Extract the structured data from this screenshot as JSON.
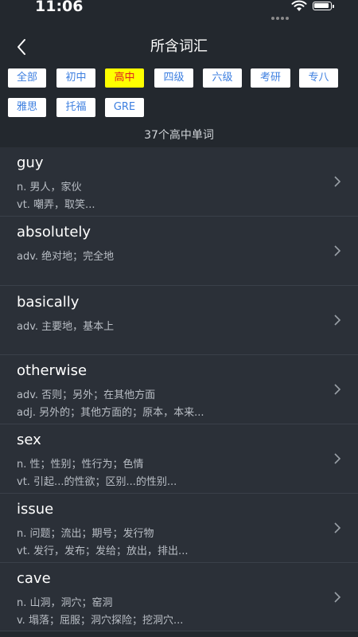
{
  "status": {
    "time": "11:06"
  },
  "nav": {
    "title": "所含词汇"
  },
  "filters": [
    {
      "label": "全部",
      "active": false
    },
    {
      "label": "初中",
      "active": false
    },
    {
      "label": "高中",
      "active": true
    },
    {
      "label": "四级",
      "active": false
    },
    {
      "label": "六级",
      "active": false
    },
    {
      "label": "考研",
      "active": false
    },
    {
      "label": "专八",
      "active": false
    },
    {
      "label": "雅思",
      "active": false
    },
    {
      "label": "托福",
      "active": false
    },
    {
      "label": "GRE",
      "active": false
    }
  ],
  "count_text": "37个高中单词",
  "words": [
    {
      "word": "guy",
      "defs": [
        "n. 男人，家伙",
        "vt. 嘲弄，取笑..."
      ]
    },
    {
      "word": "absolutely",
      "defs": [
        "adv. 绝对地；完全地"
      ]
    },
    {
      "word": "basically",
      "defs": [
        "adv. 主要地，基本上"
      ]
    },
    {
      "word": "otherwise",
      "defs": [
        "adv. 否则；另外；在其他方面",
        "adj. 另外的；其他方面的；原本，本来..."
      ]
    },
    {
      "word": "sex",
      "defs": [
        "n. 性；性别；性行为；色情",
        "vt. 引起...的性欲；区别...的性别..."
      ]
    },
    {
      "word": "issue",
      "defs": [
        "n. 问题；流出；期号；发行物",
        "vt. 发行，发布；发给；放出，排出..."
      ]
    },
    {
      "word": "cave",
      "defs": [
        "n. 山洞，洞穴；窑洞",
        "v. 塌落；屈服；洞穴探险；挖洞穴..."
      ]
    }
  ],
  "colors": {
    "active_chip": "#ffff00",
    "active_text": "#e02020",
    "chip_text": "#3d7fe0"
  }
}
